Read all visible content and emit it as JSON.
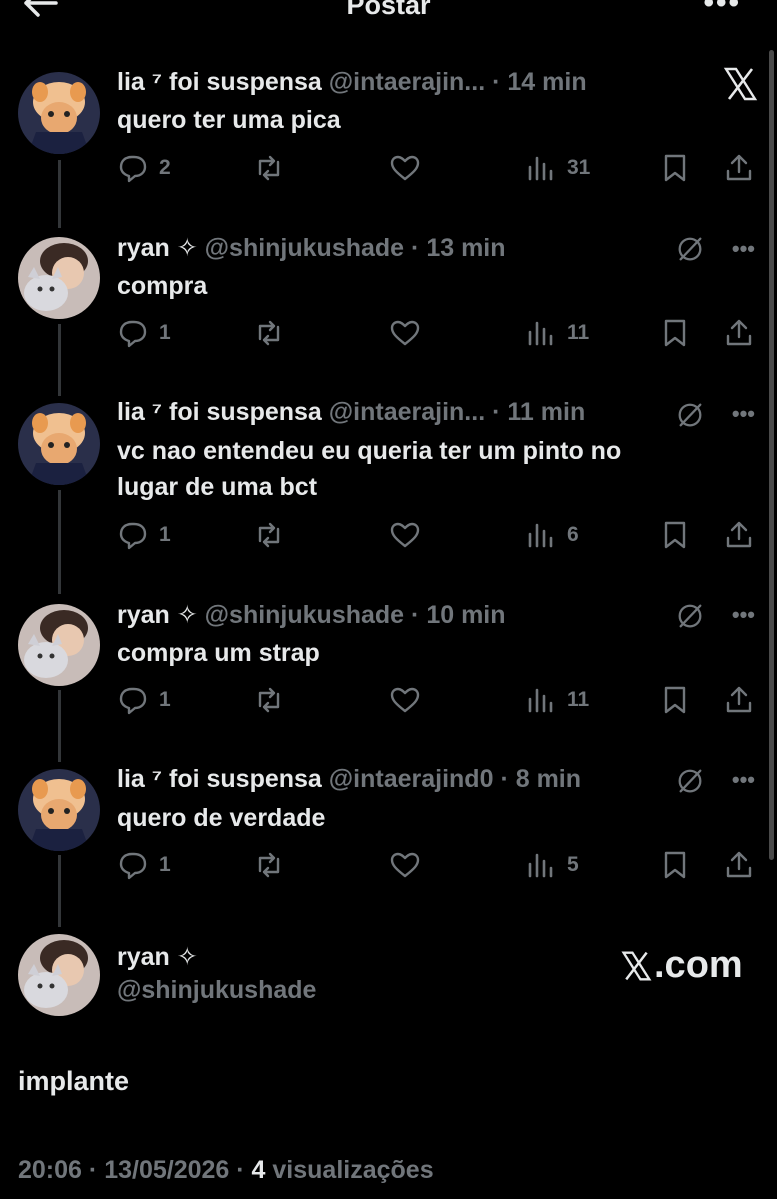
{
  "header": {
    "title": "Postar"
  },
  "tweets": [
    {
      "name": "lia ⁷ foi suspensa",
      "handle": "@intaerajin...",
      "time": "14 min",
      "text": "quero ter uma pica",
      "replies": "2",
      "views": "31"
    },
    {
      "name": "ryan ✧",
      "handle": "@shinjukushade",
      "time": "13 min",
      "text": "compra",
      "replies": "1",
      "views": "11"
    },
    {
      "name": "lia ⁷ foi suspensa",
      "handle": "@intaerajin...",
      "time": "11 min",
      "text_line1": "vc nao entendeu eu queria ter um pinto no",
      "text_line2": "lugar de uma bct",
      "replies": "1",
      "views": "6"
    },
    {
      "name": "ryan ✧",
      "handle": "@shinjukushade",
      "time": "10 min",
      "text": "compra um strap",
      "replies": "1",
      "views": "11"
    },
    {
      "name": "lia ⁷ foi suspensa",
      "handle": "@intaerajind0",
      "time": "8 min",
      "text": "quero de verdade",
      "replies": "1",
      "views": "5"
    }
  ],
  "main": {
    "name": "ryan ✧",
    "handle": "@shinjukushade",
    "text": "implante",
    "time": "20:06",
    "date": "13/05/2026",
    "views_count": "4",
    "views_label": "visualizações"
  },
  "watermark": {
    "text": ".com"
  },
  "colors": {
    "background": "#000000",
    "text": "#e7e9ea",
    "muted": "#71767b"
  }
}
